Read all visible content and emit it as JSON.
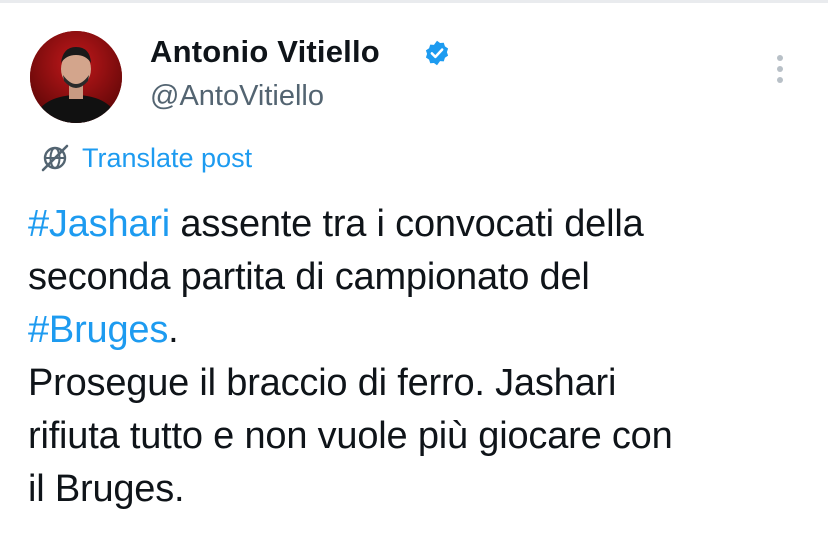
{
  "author": {
    "name": "Antonio Vitiello",
    "handle": "@AntoVitiello",
    "verified": true
  },
  "icons": {
    "verified": "verified-badge-icon",
    "more": "more-vertical-icon",
    "translate": "translate-globe-icon"
  },
  "translate_label": "Translate post",
  "tweet": {
    "line1_hashtag": "#Jashari",
    "line1_text": " assente tra i convocati della",
    "line2_text": "seconda partita di campionato del",
    "line3_hashtag": "#Bruges",
    "line3_text": ".",
    "line4_text": "Prosegue il braccio di ferro. Jashari",
    "line5_text": "rifiuta tutto e non vuole più giocare con",
    "line6_text": "il Bruges."
  },
  "colors": {
    "accent": "#1d9bf0",
    "text": "#0f1419",
    "secondary": "#536471",
    "avatar_bg": "#8a0f0f"
  }
}
